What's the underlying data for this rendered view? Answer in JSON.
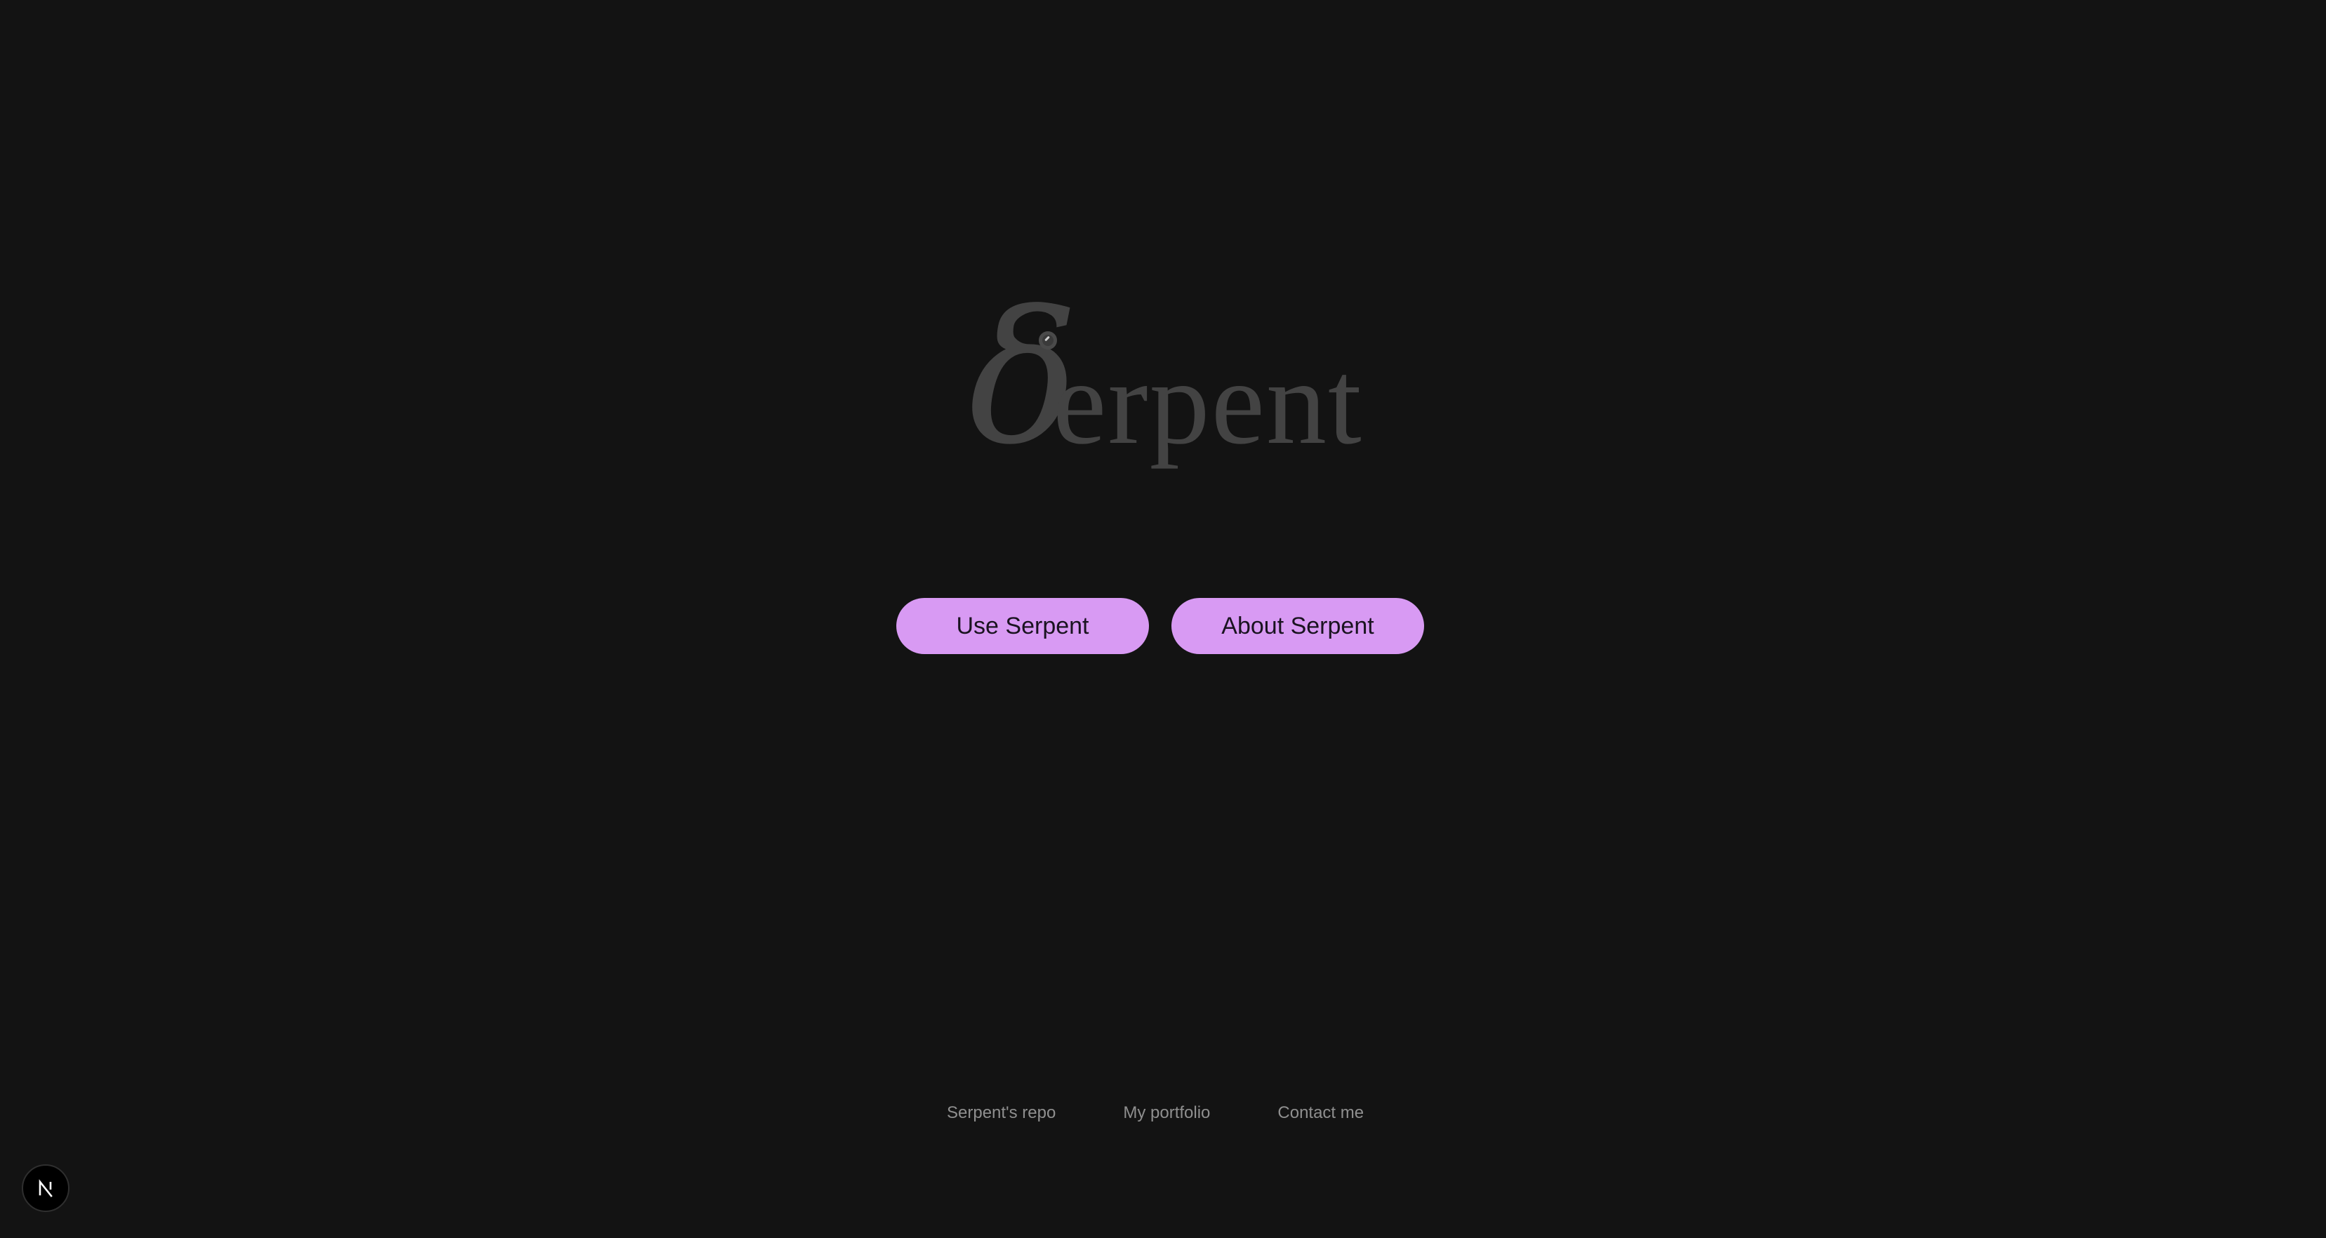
{
  "logo": {
    "glyph": "δ",
    "text": "erpent"
  },
  "actions": {
    "use_label": "Use Serpent",
    "about_label": "About Serpent"
  },
  "footer": {
    "links": [
      {
        "label": "Serpent's repo"
      },
      {
        "label": "My portfolio"
      },
      {
        "label": "Contact me"
      }
    ]
  },
  "badge": {
    "icon": "nextjs-icon"
  },
  "colors": {
    "background": "#131313",
    "logo": "#434343",
    "button": "#d89af3",
    "button_text": "#1a1320",
    "footer_link": "#8f8f8f"
  }
}
